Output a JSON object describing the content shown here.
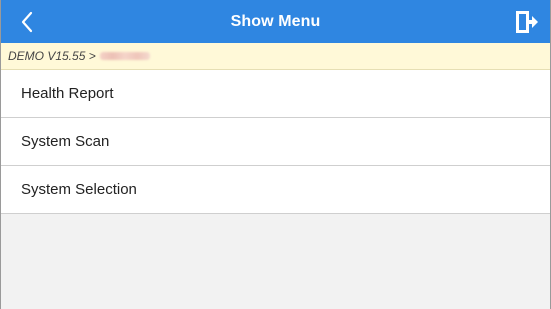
{
  "header": {
    "title": "Show Menu",
    "back_icon": "chevron-left-icon",
    "exit_icon": "exit-door-icon",
    "bg_color": "#2f86e1"
  },
  "breadcrumb": {
    "text": "DEMO V15.55 >",
    "bg_color": "#fff9d8"
  },
  "menu": {
    "items": [
      {
        "label": "Health Report"
      },
      {
        "label": "System Scan"
      },
      {
        "label": "System Selection"
      }
    ]
  }
}
